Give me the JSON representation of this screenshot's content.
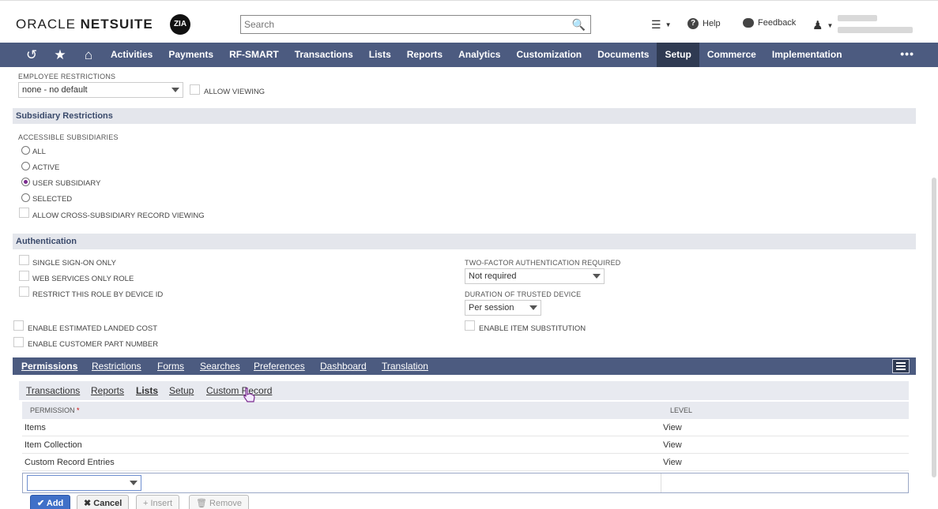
{
  "header": {
    "logo_light": "ORACLE ",
    "logo_bold": "NETSUITE",
    "zia": "ZIA",
    "search_placeholder": "Search",
    "help_label": "Help",
    "feedback_label": "Feedback"
  },
  "nav": {
    "items": [
      "Activities",
      "Payments",
      "RF-SMART",
      "Transactions",
      "Lists",
      "Reports",
      "Analytics",
      "Customization",
      "Documents",
      "Setup",
      "Commerce",
      "Implementation"
    ],
    "active": "Setup",
    "more": "•••"
  },
  "employee_restrictions": {
    "label": "EMPLOYEE RESTRICTIONS",
    "value": "none - no default",
    "allow_viewing": "ALLOW VIEWING"
  },
  "subsidiary": {
    "section_title": "Subsidiary Restrictions",
    "label": "ACCESSIBLE SUBSIDIARIES",
    "options": [
      "ALL",
      "ACTIVE",
      "USER SUBSIDIARY",
      "SELECTED"
    ],
    "selected": "USER SUBSIDIARY",
    "cross_viewing": "ALLOW CROSS-SUBSIDIARY RECORD VIEWING"
  },
  "authentication": {
    "section_title": "Authentication",
    "sso": "SINGLE SIGN-ON ONLY",
    "web_services": "WEB SERVICES ONLY ROLE",
    "restrict_device": "RESTRICT THIS ROLE BY DEVICE ID",
    "two_factor_label": "TWO-FACTOR AUTHENTICATION REQUIRED",
    "two_factor_value": "Not required",
    "trusted_label": "DURATION OF TRUSTED DEVICE",
    "trusted_value": "Per session"
  },
  "misc": {
    "landed_cost": "ENABLE ESTIMATED LANDED COST",
    "customer_part": "ENABLE CUSTOMER PART NUMBER",
    "item_substitution": "ENABLE ITEM SUBSTITUTION"
  },
  "tabs": [
    "Permissions",
    "Restrictions",
    "Forms",
    "Searches",
    "Preferences",
    "Dashboard",
    "Translation"
  ],
  "subtabs": [
    "Transactions",
    "Reports",
    "Lists",
    "Setup",
    "Custom Record"
  ],
  "table": {
    "col_permission": "PERMISSION",
    "col_level": "LEVEL",
    "rows": [
      {
        "permission": "Items",
        "level": "View"
      },
      {
        "permission": "Item Collection",
        "level": "View"
      },
      {
        "permission": "Custom Record Entries",
        "level": "View"
      }
    ]
  },
  "buttons": {
    "add": "Add",
    "cancel": "Cancel",
    "insert": "Insert",
    "remove": "Remove"
  },
  "colors": {
    "nav_bg": "#4c5b80",
    "nav_active": "#2f3a52",
    "section_bg": "#e4e6ec",
    "radio_selected": "#7b2c8f",
    "add_button": "#4070c8"
  }
}
